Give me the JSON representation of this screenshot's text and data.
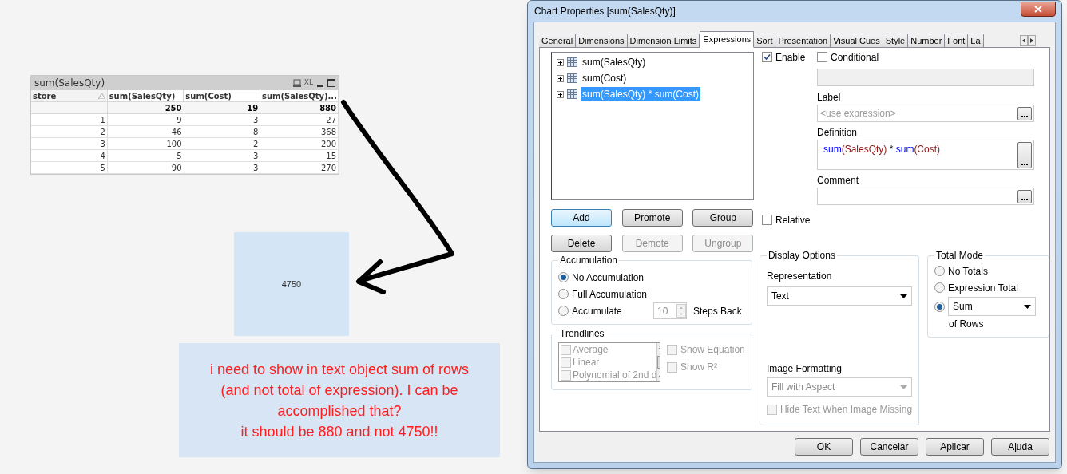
{
  "canvas": {
    "table": {
      "title": "sum(SalesQty)",
      "xl_label": "XL",
      "columns": [
        {
          "label": "store",
          "sorted": true
        },
        {
          "label": "sum(SalesQty)",
          "sorted": false
        },
        {
          "label": "sum(Cost)",
          "sorted": false
        },
        {
          "label": "sum(SalesQty)...",
          "sorted": false
        }
      ],
      "totals": [
        "250",
        "19",
        "880"
      ],
      "rows": [
        [
          "1",
          "9",
          "3",
          "27"
        ],
        [
          "2",
          "46",
          "8",
          "368"
        ],
        [
          "3",
          "100",
          "2",
          "200"
        ],
        [
          "4",
          "5",
          "3",
          "15"
        ],
        [
          "5",
          "90",
          "3",
          "270"
        ]
      ]
    },
    "text_object": {
      "value": "4750"
    },
    "note": {
      "text": "i need to show in text object sum of rows (and not total of expression). I can be accomplished that?\nit should be 880 and not 4750!!"
    }
  },
  "dialog": {
    "title": "Chart Properties [sum(SalesQty)]",
    "tabs": [
      {
        "label": "General",
        "selected": false
      },
      {
        "label": "Dimensions",
        "selected": false
      },
      {
        "label": "Dimension Limits",
        "selected": false
      },
      {
        "label": "Expressions",
        "selected": true
      },
      {
        "label": "Sort",
        "selected": false
      },
      {
        "label": "Presentation",
        "selected": false
      },
      {
        "label": "Visual Cues",
        "selected": false
      },
      {
        "label": "Style",
        "selected": false
      },
      {
        "label": "Number",
        "selected": false
      },
      {
        "label": "Font",
        "selected": false
      },
      {
        "label": "La",
        "selected": false
      }
    ],
    "expressions": [
      {
        "label": "sum(SalesQty)",
        "selected": false
      },
      {
        "label": "sum(Cost)",
        "selected": false
      },
      {
        "label": "sum(SalesQty) * sum(Cost)",
        "selected": true
      }
    ],
    "enable": {
      "label": "Enable",
      "checked": true
    },
    "conditional": {
      "label": "Conditional",
      "checked": false
    },
    "label_field": {
      "label": "Label",
      "placeholder": "<use expression>"
    },
    "definition": {
      "label": "Definition",
      "tokens": [
        {
          "text": "sum",
          "kind": "function"
        },
        {
          "text": "(SalesQty)",
          "kind": "field"
        },
        {
          "text": " * ",
          "kind": "operator"
        },
        {
          "text": "sum",
          "kind": "function"
        },
        {
          "text": "(Cost)",
          "kind": "field"
        }
      ]
    },
    "comment": {
      "label": "Comment"
    },
    "buttons": [
      {
        "label": "Add",
        "disabled": false,
        "default": true
      },
      {
        "label": "Promote",
        "disabled": false,
        "default": false
      },
      {
        "label": "Group",
        "disabled": false,
        "default": false
      },
      {
        "label": "Delete",
        "disabled": false,
        "default": false
      },
      {
        "label": "Demote",
        "disabled": true,
        "default": false
      },
      {
        "label": "Ungroup",
        "disabled": true,
        "default": false
      }
    ],
    "relative": {
      "label": "Relative",
      "checked": false
    },
    "accumulation": {
      "title": "Accumulation",
      "options": [
        {
          "label": "No Accumulation",
          "selected": true
        },
        {
          "label": "Full Accumulation",
          "selected": false
        },
        {
          "label": "Accumulate",
          "selected": false
        }
      ],
      "steps": "10",
      "steps_label": "Steps Back"
    },
    "trendlines": {
      "title": "Trendlines",
      "disabled": true,
      "items": [
        {
          "label": "Average",
          "checked": false
        },
        {
          "label": "Linear",
          "checked": false
        },
        {
          "label": "Polynomial of 2nd d",
          "checked": false
        }
      ],
      "show_equation": {
        "label": "Show Equation",
        "checked": false
      },
      "show_r2": {
        "label": "Show R²",
        "checked": false
      }
    },
    "display_options": {
      "title": "Display Options",
      "representation_label": "Representation",
      "representation": {
        "value": "Text",
        "disabled": false
      },
      "image_formatting_label": "Image Formatting",
      "image_formatting": {
        "value": "Fill with Aspect",
        "disabled": true
      },
      "hide_text": {
        "label": "Hide Text When Image Missing",
        "checked": false,
        "disabled": true
      }
    },
    "total_mode": {
      "title": "Total Mode",
      "options": [
        {
          "kind": "radio",
          "label": "No Totals",
          "selected": false
        },
        {
          "kind": "radio",
          "label": "Expression Total",
          "selected": false
        },
        {
          "kind": "select",
          "value": "Sum",
          "selected": true
        }
      ],
      "suffix": "of Rows"
    },
    "footer_buttons": [
      "OK",
      "Cancelar",
      "Aplicar",
      "Ajuda"
    ]
  }
}
